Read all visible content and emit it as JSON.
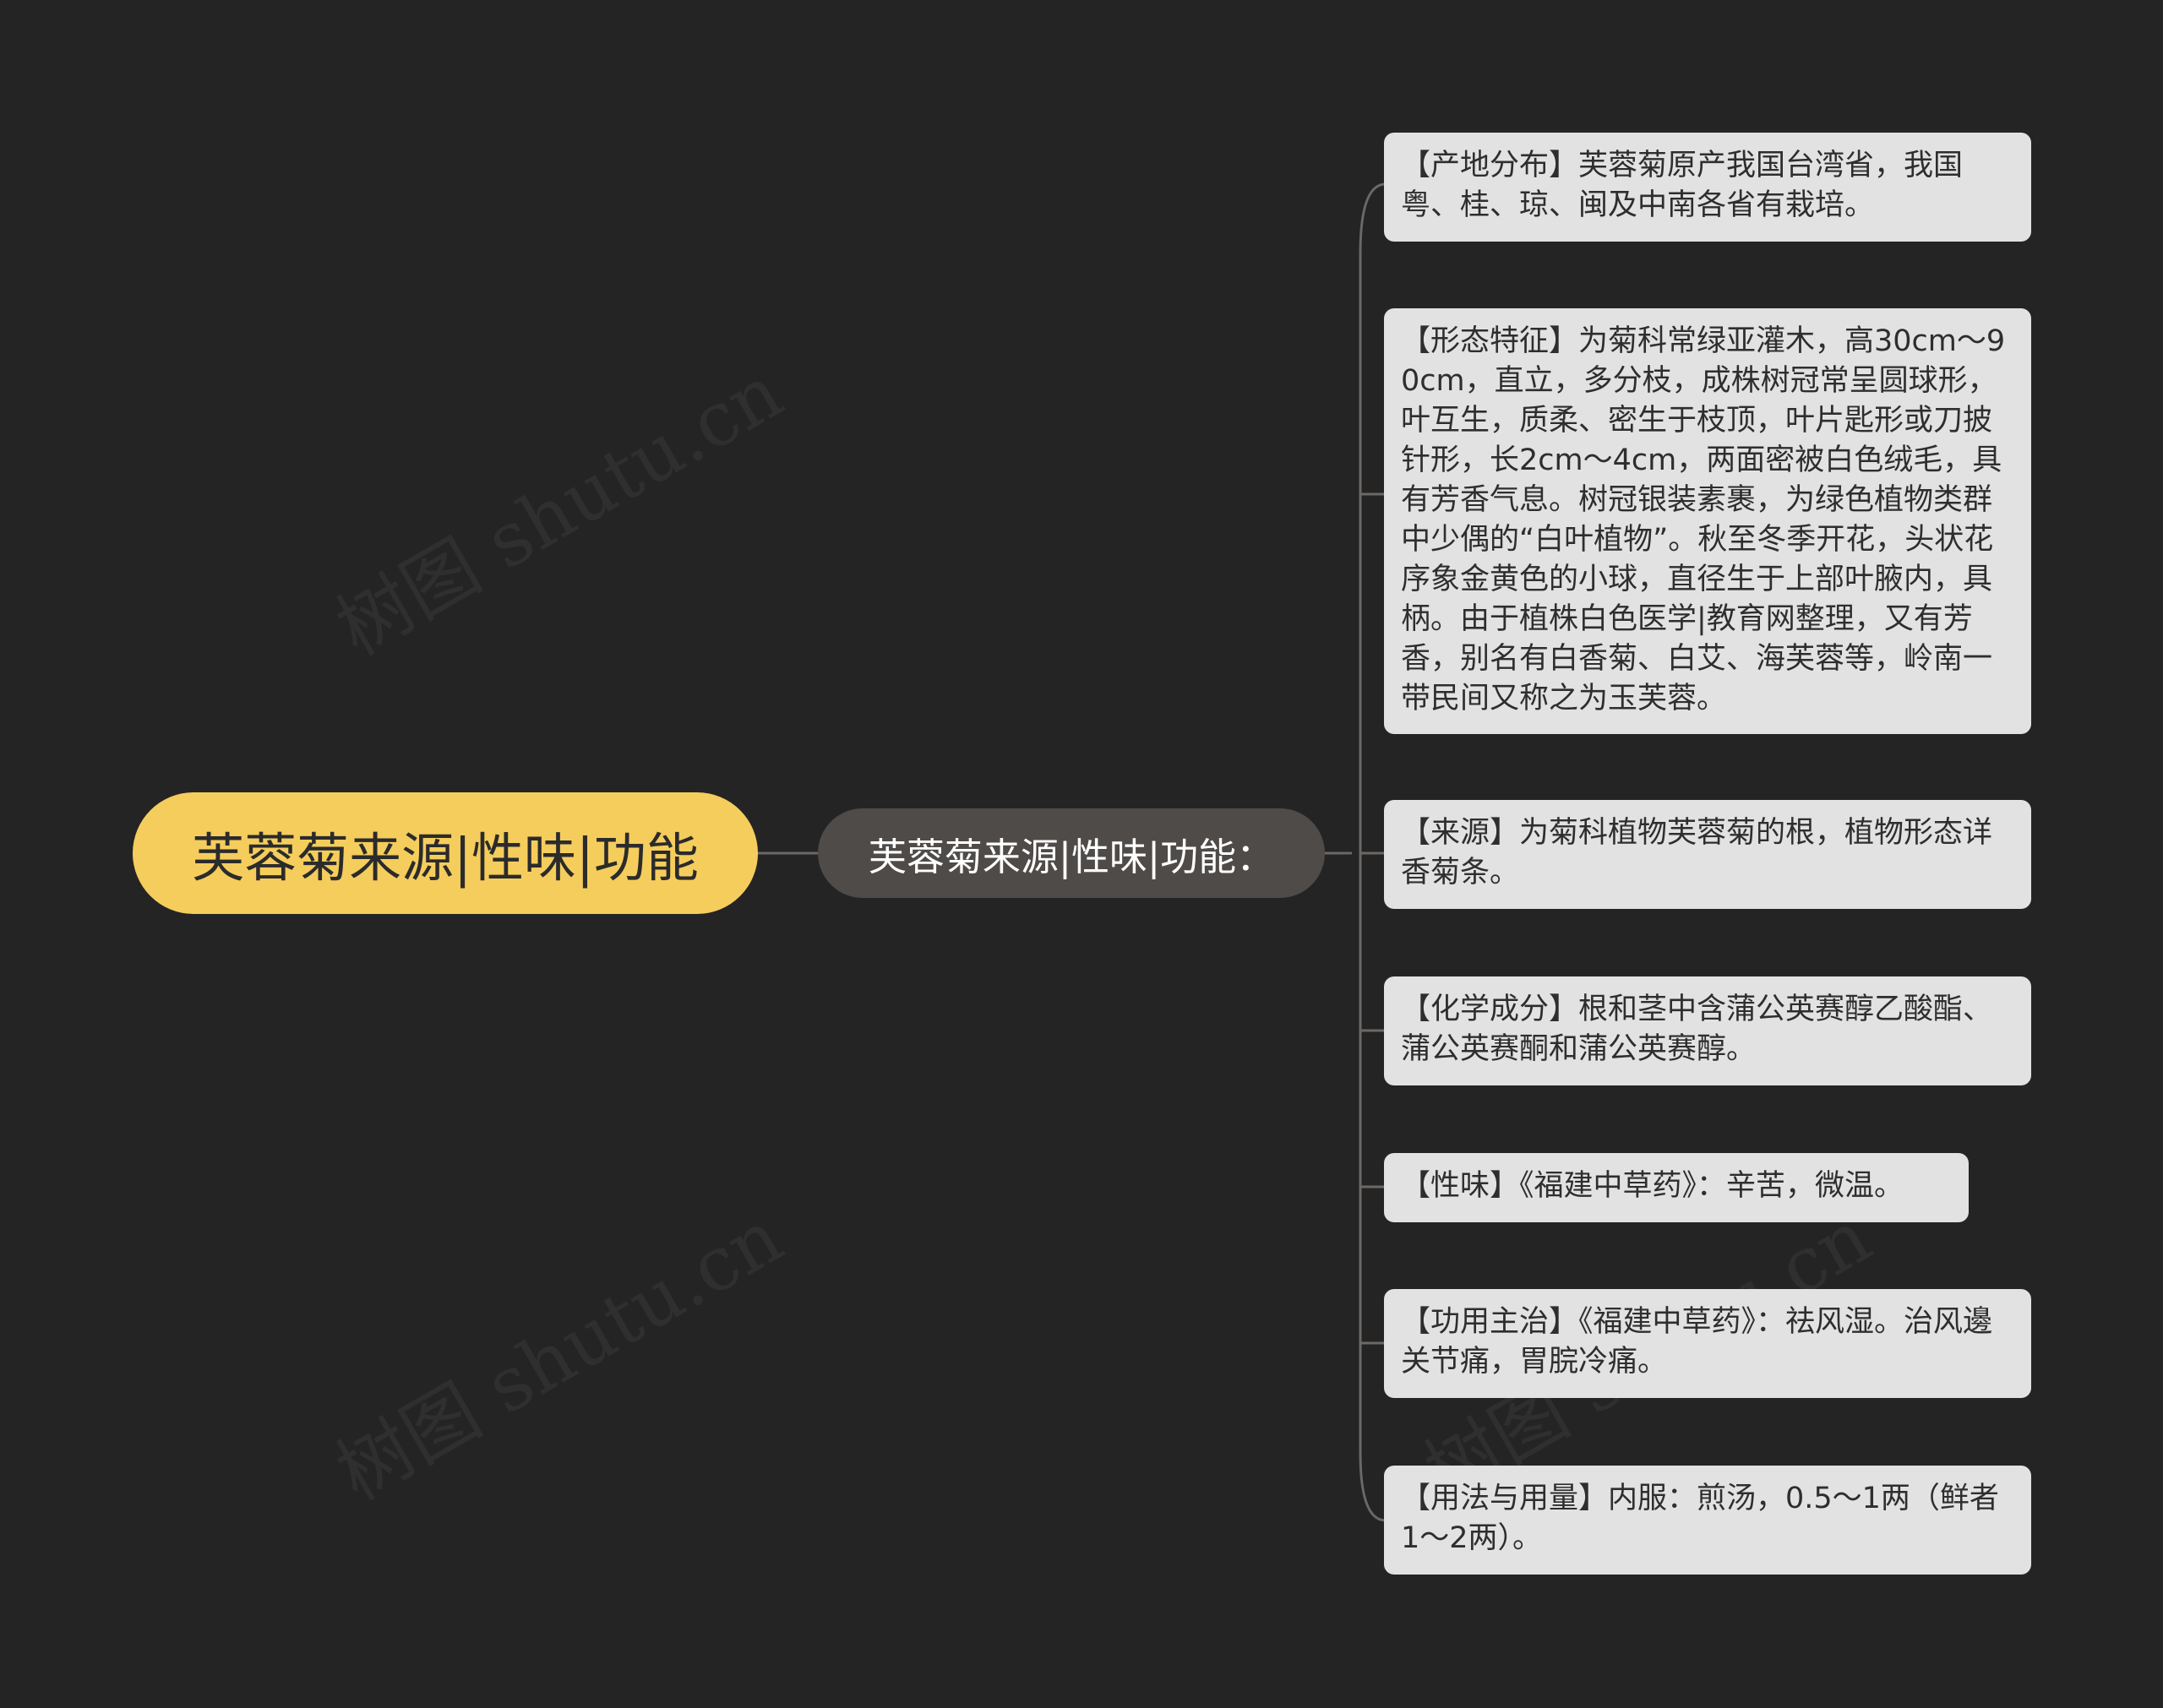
{
  "diagram": {
    "root": {
      "label": "芙蓉菊来源|性味|功能"
    },
    "branch": {
      "label": "芙蓉菊来源|性味|功能："
    },
    "leaves": [
      {
        "text": "【产地分布】芙蓉菊原产我国台湾省，我国粤、桂、琼、闽及中南各省有栽培。"
      },
      {
        "text": "【形态特征】为菊科常绿亚灌木，高30cm～90cm，直立，多分枝，成株树冠常呈圆球形，叶互生，质柔、密生于枝顶，叶片匙形或刀披针形，长2cm～4cm，两面密被白色绒毛，具有芳香气息。树冠银装素裹，为绿色植物类群中少偶的“白叶植物”。秋至冬季开花，头状花序象金黄色的小球，直径生于上部叶腋内，具柄。由于植株白色医学|教育网整理，又有芳香，别名有白香菊、白艾、海芙蓉等，岭南一带民间又称之为玉芙蓉。"
      },
      {
        "text": "【来源】为菊科植物芙蓉菊的根，植物形态详香菊条。"
      },
      {
        "text": "【化学成分】根和茎中含蒲公英赛醇乙酸酯、蒲公英赛酮和蒲公英赛醇。"
      },
      {
        "text": "【性味】《福建中草药》：辛苦，微温。"
      },
      {
        "text": "【功用主治】《福建中草药》：祛风湿。治风邊关节痛，胃脘冷痛。"
      },
      {
        "text": "【用法与用量】内服：煎汤，0.5～1两（鲜者1～2两）。"
      }
    ]
  },
  "watermark": {
    "text": "树图 shutu.cn"
  },
  "colors": {
    "background": "#242424",
    "root_fill": "#f5cd5c",
    "branch_fill": "#4e4b49",
    "leaf_fill": "#e2e2e2",
    "connector": "#6b6866"
  }
}
